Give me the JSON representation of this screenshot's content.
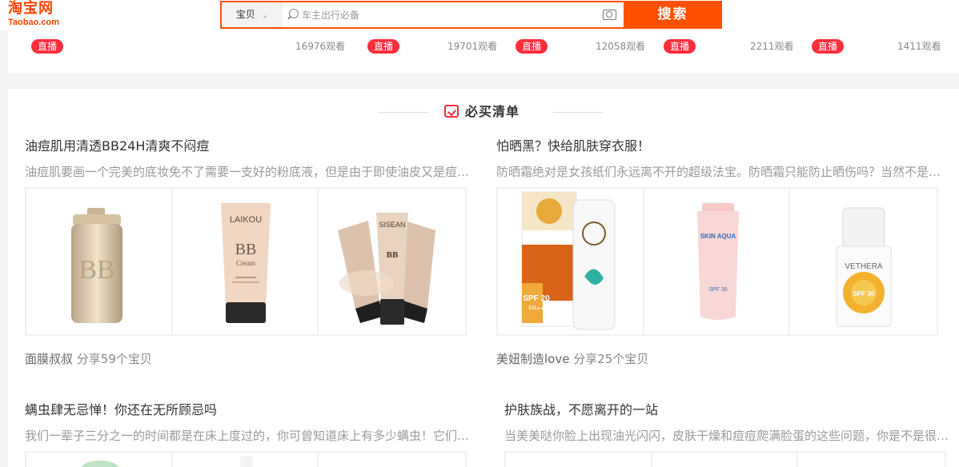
{
  "header": {
    "logo_cn": "淘宝网",
    "logo_en": "Taobao.com",
    "search_category": "宝贝",
    "search_placeholder": "车主出行必备",
    "search_button": "搜索"
  },
  "live": {
    "badge_label": "直播",
    "items": [
      {
        "views": "16976观看"
      },
      {
        "views": "19701观看"
      },
      {
        "views": "12058观看"
      },
      {
        "views": "2211观看"
      },
      {
        "views": "1411观看"
      }
    ]
  },
  "section": {
    "title": "必买清单"
  },
  "cards": [
    {
      "title": "油痘肌用清透BB24H清爽不闷痘",
      "desc": "油痘肌要画一个完美的底妆免不了需要一支好的粉底液，但是由于即使油皮又是痘痘肌，所以选择粉底液的时候需要格外小心",
      "author": "面膜叔叔",
      "share": " 分享59个宝贝",
      "products": [
        {
          "brand": "BB",
          "name": "gold-bb-cream"
        },
        {
          "brand": "LAIKOU",
          "sub": "BB",
          "sub2": "Cream",
          "name": "laikou-bb-cream"
        },
        {
          "brand": "SISEAN",
          "sub": "BB",
          "name": "sisean-bb-set"
        }
      ]
    },
    {
      "title": "怕晒黑？快给肌肤穿衣服！",
      "desc": "防晒霜绝对是女孩纸们永远离不开的超级法宝。防晒霜只能防止晒伤吗？当然不是，它还可以防止皮肤老化",
      "author": "美妞制造love",
      "share": " 分享25个宝贝",
      "products": [
        {
          "brand": "SPF 20",
          "sub": "PA++",
          "name": "herbal-sunscreen"
        },
        {
          "brand": "SKIN AQUA",
          "sub": "SPF 30",
          "name": "skin-aqua-sunscreen"
        },
        {
          "brand": "VETHERA",
          "sub": "SPF 30",
          "name": "vethera-sunscreen"
        }
      ]
    },
    {
      "title": "螨虫肆无忌惮！你还在无所顾忌吗",
      "desc": "我们一辈子三分之一的时间都是在床上度过的，你可曾知道床上有多少螨虫！它们让你的皮肤瘙痒过敏"
    },
    {
      "title": "护肤族战，不愿离开的一站",
      "desc": "当美美哒你脸上出现油光闪闪，皮肤干燥和痘痘爬满脸蛋的这些问题，你是不是很苦恼该怎么办呢"
    }
  ],
  "colors": {
    "brand": "#ff5000",
    "live_badge": "#ff2e3c"
  }
}
